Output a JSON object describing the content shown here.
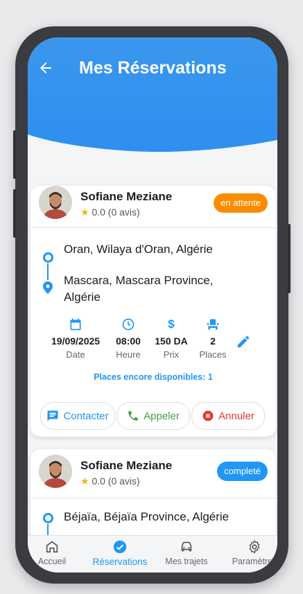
{
  "header": {
    "title": "Mes Réservations"
  },
  "reservations": [
    {
      "driver_name": "Sofiane Meziane",
      "rating": "0.0 (0 avis)",
      "status": "en attente",
      "status_color": "#fb8c00",
      "from": "Oran, Wilaya d'Oran, Algérie",
      "to_line1": "Mascara, Mascara Province,",
      "to_line2": "Algérie",
      "date": "19/09/2025",
      "date_label": "Date",
      "time": "08:00",
      "time_label": "Heure",
      "price": "150 DA",
      "price_label": "Prix",
      "seats": "2",
      "seats_label": "Places",
      "availability": "Places encore disponibles: 1",
      "actions": {
        "contact": "Contacter",
        "call": "Appeler",
        "cancel": "Annuler"
      }
    },
    {
      "driver_name": "Sofiane Meziane",
      "rating": "0.0 (0 avis)",
      "status": "completé",
      "status_color": "#2196f3",
      "from": "Béjaïa, Béjaïa Province, Algérie"
    }
  ],
  "nav": [
    {
      "label": "Accueil",
      "icon": "home-icon"
    },
    {
      "label": "Réservations",
      "icon": "check-circle-icon",
      "active": true
    },
    {
      "label": "Mes trajets",
      "icon": "car-icon"
    },
    {
      "label": "Paramètres",
      "icon": "gear-icon"
    }
  ],
  "colors": {
    "primary": "#2196f3",
    "pending": "#fb8c00",
    "call": "#43a047",
    "cancel": "#e53935"
  }
}
